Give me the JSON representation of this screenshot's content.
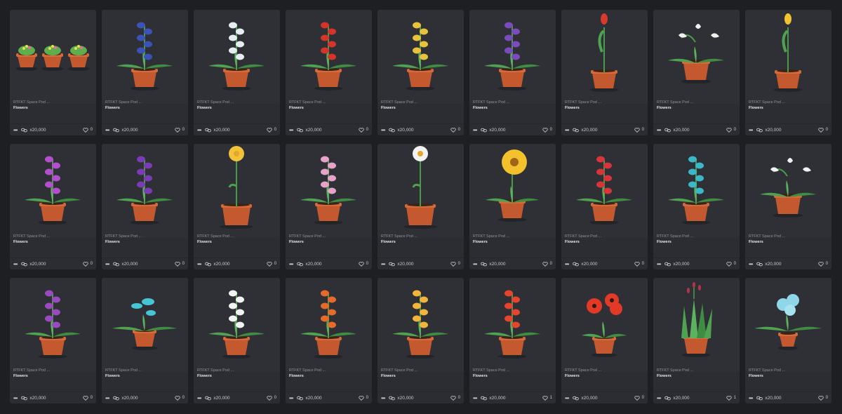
{
  "colors": {
    "background": "#1e1f22",
    "card": "#2b2d32",
    "text_muted": "#8f9198",
    "text": "#e6e6e6",
    "pot": "#c4582e",
    "leaf": "#4fa252"
  },
  "cards": [
    {
      "title": "RTFKT Space Pod ...",
      "collection": "Flowers",
      "supply": "x20,000",
      "likes": "0",
      "plant": "cactus-trio",
      "bloom": "#e3e24a"
    },
    {
      "title": "RTFKT Space Pod ...",
      "collection": "Flowers",
      "supply": "x20,000",
      "likes": "0",
      "plant": "blue-blossom",
      "bloom": "#3b53b8"
    },
    {
      "title": "RTFKT Space Pod ...",
      "collection": "Flowers",
      "supply": "x20,000",
      "likes": "0",
      "plant": "hyacinth-white",
      "bloom": "#e6ecef"
    },
    {
      "title": "RTFKT Space Pod ...",
      "collection": "Flowers",
      "supply": "x20,000",
      "likes": "0",
      "plant": "red-spike",
      "bloom": "#d6342a"
    },
    {
      "title": "RTFKT Space Pod ...",
      "collection": "Flowers",
      "supply": "x20,000",
      "likes": "0",
      "plant": "yellow-orchid",
      "bloom": "#e8c23a"
    },
    {
      "title": "RTFKT Space Pod ...",
      "collection": "Flowers",
      "supply": "x20,000",
      "likes": "0",
      "plant": "purple-lupine",
      "bloom": "#7b4bbd"
    },
    {
      "title": "RTFKT Space Pod ...",
      "collection": "Flowers",
      "supply": "x20,000",
      "likes": "0",
      "plant": "red-tulip",
      "bloom": "#d83a2c"
    },
    {
      "title": "RTFKT Space Pod ...",
      "collection": "Flowers",
      "supply": "x20,000",
      "likes": "0",
      "plant": "calla-lily",
      "bloom": "#f0f0f0"
    },
    {
      "title": "RTFKT Space Pod ...",
      "collection": "Flowers",
      "supply": "x20,000",
      "likes": "0",
      "plant": "yellow-tulip",
      "bloom": "#f2c230"
    },
    {
      "title": "RTFKT Space Pod ...",
      "collection": "Flowers",
      "supply": "x20,000",
      "likes": "0",
      "plant": "purple-hyacinth",
      "bloom": "#b34fcf"
    },
    {
      "title": "RTFKT Space Pod ...",
      "collection": "Flowers",
      "supply": "x20,000",
      "likes": "0",
      "plant": "purple-orchid",
      "bloom": "#7b3bb8"
    },
    {
      "title": "RTFKT Space Pod ...",
      "collection": "Flowers",
      "supply": "x20,000",
      "likes": "0",
      "plant": "yellow-daisy",
      "bloom": "#f2c23a"
    },
    {
      "title": "RTFKT Space Pod ...",
      "collection": "Flowers",
      "supply": "x20,000",
      "likes": "0",
      "plant": "pink-bells",
      "bloom": "#e7a2c8"
    },
    {
      "title": "RTFKT Space Pod ...",
      "collection": "Flowers",
      "supply": "x20,000",
      "likes": "0",
      "plant": "white-daisy",
      "bloom": "#f2f2f2"
    },
    {
      "title": "RTFKT Space Pod ...",
      "collection": "Flowers",
      "supply": "x20,000",
      "likes": "0",
      "plant": "sunflower",
      "bloom": "#f2c12c"
    },
    {
      "title": "RTFKT Space Pod ...",
      "collection": "Flowers",
      "supply": "x20,000",
      "likes": "0",
      "plant": "red-buds",
      "bloom": "#d8343a"
    },
    {
      "title": "RTFKT Space Pod ...",
      "collection": "Flowers",
      "supply": "x20,000",
      "likes": "0",
      "plant": "teal-orchid",
      "bloom": "#3ab8c8"
    },
    {
      "title": "RTFKT Space Pod ...",
      "collection": "Flowers",
      "supply": "x20,000",
      "likes": "0",
      "plant": "white-calla",
      "bloom": "#f0f0f0"
    },
    {
      "title": "RTFKT Space Pod ...",
      "collection": "Flowers",
      "supply": "x20,000",
      "likes": "0",
      "plant": "foxglove",
      "bloom": "#9a4ac0"
    },
    {
      "title": "RTFKT Space Pod ...",
      "collection": "Flowers",
      "supply": "x20,000",
      "likes": "0",
      "plant": "teal-mushroom",
      "bloom": "#44c6d6"
    },
    {
      "title": "RTFKT Space Pod ...",
      "collection": "Flowers",
      "supply": "x20,000",
      "likes": "0",
      "plant": "lily-of-valley",
      "bloom": "#f2f2f2"
    },
    {
      "title": "RTFKT Space Pod ...",
      "collection": "Flowers",
      "supply": "x20,000",
      "likes": "0",
      "plant": "orange-gladiolus",
      "bloom": "#e86a2a"
    },
    {
      "title": "RTFKT Space Pod ...",
      "collection": "Flowers",
      "supply": "x20,000",
      "likes": "0",
      "plant": "yellow-primrose",
      "bloom": "#f2b43a"
    },
    {
      "title": "RTFKT Space Pod ...",
      "collection": "Flowers",
      "supply": "x20,000",
      "likes": "1",
      "plant": "red-gerbera",
      "bloom": "#e8432c"
    },
    {
      "title": "RTFKT Space Pod ...",
      "collection": "Flowers",
      "supply": "x20,000",
      "likes": "0",
      "plant": "red-poppy",
      "bloom": "#e33a28"
    },
    {
      "title": "RTFKT Space Pod ...",
      "collection": "Flowers",
      "supply": "x20,000",
      "likes": "1",
      "plant": "grass-cattail",
      "bloom": "#b8334a"
    },
    {
      "title": "RTFKT Space Pod ...",
      "collection": "Flowers",
      "supply": "x20,000",
      "likes": "0",
      "plant": "blue-hydrangea",
      "bloom": "#8fd6e8"
    }
  ]
}
